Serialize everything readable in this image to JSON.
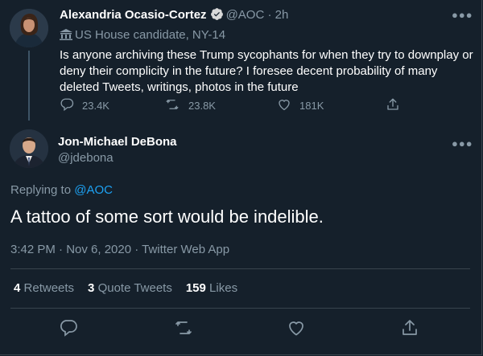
{
  "parent_tweet": {
    "author_name": "Alexandria Ocasio-Cortez",
    "author_handle": "@AOC",
    "time_ago": "2h",
    "label": "US House candidate, NY-14",
    "text": "Is anyone archiving these Trump sycophants for when they try to downplay or deny their complicity in the future? I foresee decent probability of many deleted Tweets, writings, photos in the future",
    "reply_count": "23.4K",
    "retweet_count": "23.8K",
    "like_count": "181K"
  },
  "reply_tweet": {
    "author_name": "Jon-Michael DeBona",
    "author_handle": "@jdebona",
    "replying_prefix": "Replying to",
    "replying_to": "@AOC",
    "text": "A tattoo of some sort would be indelible.",
    "timestamp": "3:42 PM · Nov 6, 2020 · Twitter Web App",
    "retweets_count": "4",
    "retweets_label": "Retweets",
    "quote_count": "3",
    "quote_label": "Quote Tweets",
    "likes_count": "159",
    "likes_label": "Likes"
  },
  "icons": [
    "verified-icon",
    "government-building-icon",
    "reply-icon",
    "retweet-icon",
    "like-icon",
    "share-icon",
    "more-icon"
  ],
  "colors": {
    "background": "#15202b",
    "accent": "#1da1f2",
    "muted": "#8899a6",
    "divider": "#38444d"
  }
}
